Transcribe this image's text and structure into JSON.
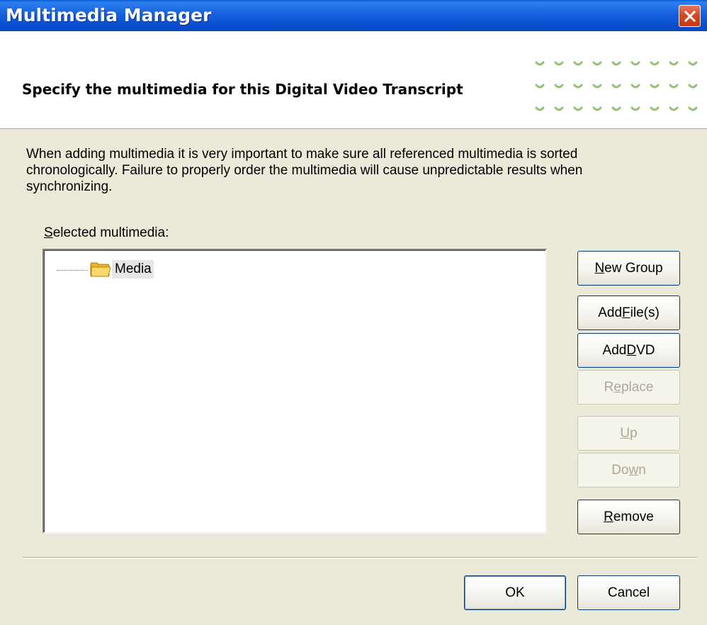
{
  "window": {
    "title": "Multimedia Manager",
    "close_icon": "close-icon"
  },
  "header": {
    "title": "Specify the multimedia for this Digital Video Transcript",
    "decoration_icon": "dots-decoration"
  },
  "description": "When adding multimedia it is very important to make sure all referenced multimedia is sorted chronologically.  Failure to properly order the multimedia will cause unpredictable results when synchronizing.",
  "selected_label": {
    "mnemonic": "S",
    "rest": "elected multimedia:"
  },
  "tree": {
    "items": [
      {
        "label": "Media",
        "icon": "folder-icon"
      }
    ]
  },
  "buttons": {
    "new_group": {
      "mnemonic": "N",
      "rest": "ew Group",
      "enabled": true
    },
    "add_files": {
      "pre": "Add ",
      "mnemonic": "F",
      "rest": "ile(s)",
      "enabled": true
    },
    "add_dvd": {
      "pre": "Add ",
      "mnemonic": "D",
      "rest": "VD",
      "enabled": true
    },
    "replace": {
      "pre": "R",
      "mnemonic": "e",
      "rest": "place",
      "enabled": false
    },
    "up": {
      "mnemonic": "U",
      "rest": "p",
      "enabled": false
    },
    "down": {
      "pre": "Do",
      "mnemonic": "w",
      "rest": "n",
      "enabled": false
    },
    "remove": {
      "mnemonic": "R",
      "rest": "emove",
      "enabled": true
    },
    "ok": {
      "label": "OK"
    },
    "cancel": {
      "label": "Cancel"
    }
  },
  "colors": {
    "titlebar": "#0b50d2",
    "dialog_bg": "#ece9d8",
    "accent_dots": "#8fc474"
  }
}
